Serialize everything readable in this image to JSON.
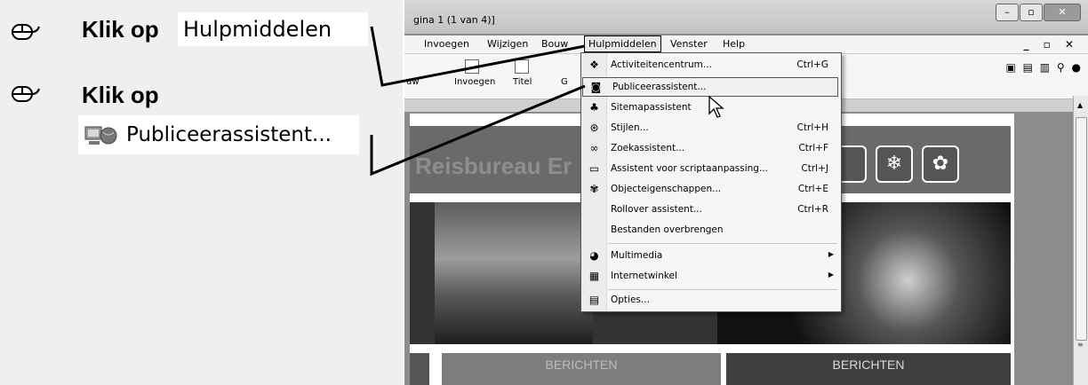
{
  "instructions": {
    "step1_prefix": "Klik op",
    "step1_target": "Hulpmiddelen",
    "step2_prefix": "Klik op",
    "step2_target": "Publiceerassistent..."
  },
  "window": {
    "title": "gina 1 (1 van 4)]"
  },
  "menubar": {
    "items": [
      "Invoegen",
      "Wijzigen",
      "Bouw",
      "Hulpmiddelen",
      "Venster",
      "Help"
    ],
    "mdi_controls": "_ ▫ ✕"
  },
  "toolbar": {
    "labels": [
      "uw",
      "Invoegen",
      "Titel",
      "G"
    ]
  },
  "website": {
    "banner_title": "Reisbureau Er",
    "nav_left": "BERICHTEN",
    "nav_right": "BERICHTEN"
  },
  "tools_menu": {
    "items": [
      {
        "label": "Activiteitencentrum...",
        "shortcut": "Ctrl+G",
        "icon": "activity-center-icon"
      },
      {
        "label": "Publiceerassistent...",
        "shortcut": "",
        "icon": "publish-wizard-icon",
        "highlighted": true
      },
      {
        "label": "Sitemapassistent",
        "shortcut": "",
        "icon": "sitemap-icon"
      },
      {
        "label": "Stijlen...",
        "shortcut": "Ctrl+H",
        "icon": "styles-icon"
      },
      {
        "label": "Zoekassistent...",
        "shortcut": "Ctrl+F",
        "icon": "binoculars-icon"
      },
      {
        "label": "Assistent voor scriptaanpassing...",
        "shortcut": "Ctrl+J",
        "icon": "script-wizard-icon"
      },
      {
        "label": "Objecteigenschappen...",
        "shortcut": "Ctrl+E",
        "icon": "object-properties-icon"
      },
      {
        "label": "Rollover assistent...",
        "shortcut": "Ctrl+R",
        "icon": ""
      },
      {
        "label": "Bestanden overbrengen",
        "shortcut": "",
        "icon": ""
      },
      {
        "label": "Multimedia",
        "shortcut": "",
        "icon": "multimedia-icon",
        "submenu": true
      },
      {
        "label": "Internetwinkel",
        "shortcut": "",
        "icon": "internet-shop-icon",
        "submenu": true
      },
      {
        "label": "Opties...",
        "shortcut": "",
        "icon": "options-icon"
      }
    ]
  }
}
